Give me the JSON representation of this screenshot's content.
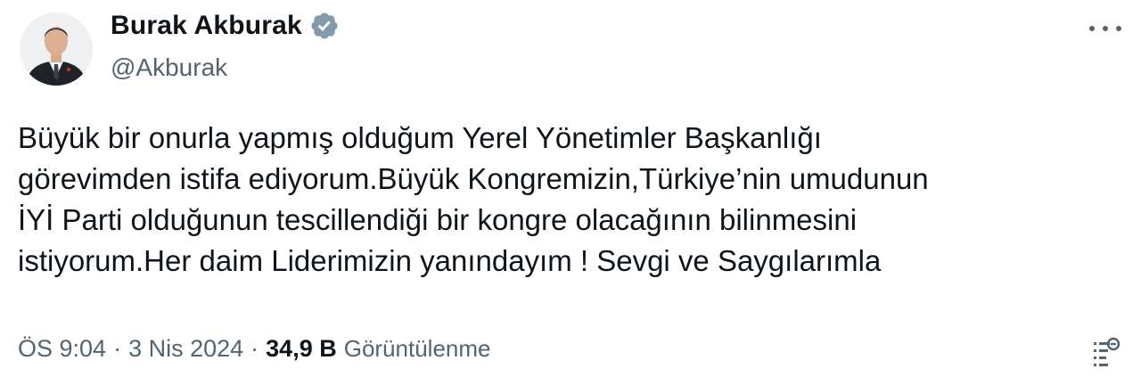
{
  "author": {
    "display_name": "Burak Akburak",
    "handle": "@Akburak",
    "verified": true
  },
  "tweet": {
    "lines": [
      "Büyük bir onurla yapmış olduğum Yerel Yönetimler Başkanlığı",
      "görevimden istifa ediyorum.Büyük Kongremizin,Türkiye’nin umudunun",
      "İYİ Parti olduğunun tescillendiği bir kongre olacağının bilinmesini",
      "istiyorum.Her daim Liderimizin yanındayım ! Sevgi ve Saygılarımla"
    ]
  },
  "meta": {
    "time": "ÖS 9:04",
    "separator": "·",
    "date": "3 Nis 2024",
    "views_count": "34,9 B",
    "views_label": "Görüntülenme"
  },
  "icons": {
    "verified": "verified-badge-icon",
    "more": "more-options-icon",
    "analytics": "analytics-icon"
  },
  "colors": {
    "verified_badge": "#829aab",
    "secondary_text": "#536471",
    "primary_text": "#0f1419"
  }
}
